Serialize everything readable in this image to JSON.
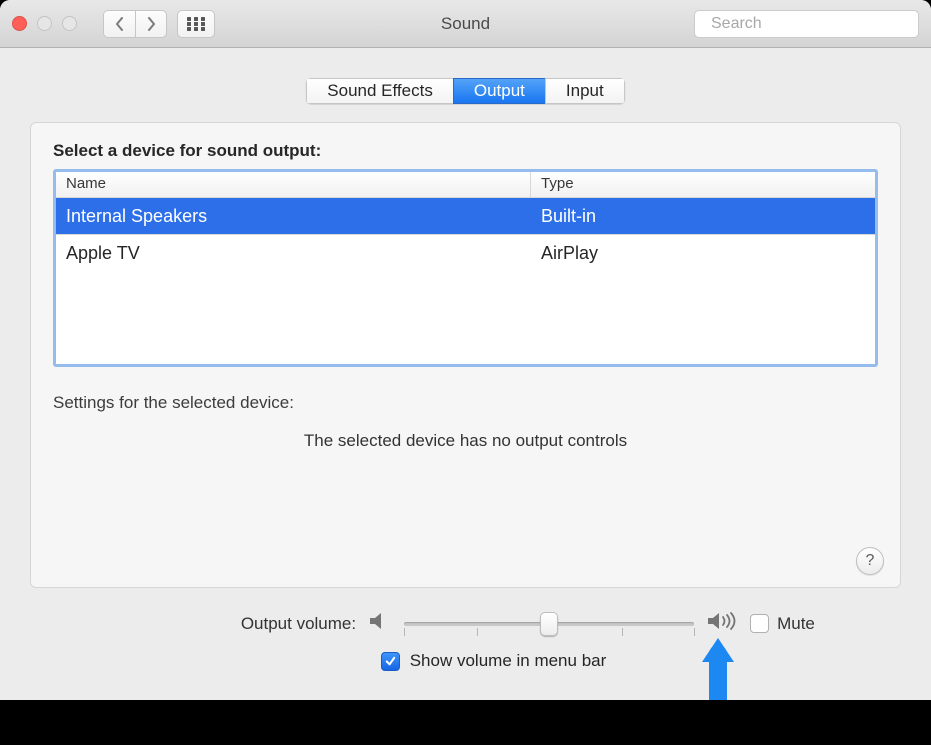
{
  "window": {
    "title": "Sound"
  },
  "search": {
    "placeholder": "Search"
  },
  "tabs": [
    {
      "label": "Sound Effects",
      "active": false
    },
    {
      "label": "Output",
      "active": true
    },
    {
      "label": "Input",
      "active": false
    }
  ],
  "section_title": "Select a device for sound output:",
  "columns": {
    "name": "Name",
    "type": "Type"
  },
  "devices": [
    {
      "name": "Internal Speakers",
      "type": "Built-in",
      "selected": true
    },
    {
      "name": "Apple TV",
      "type": "AirPlay",
      "selected": false
    }
  ],
  "settings_label": "Settings for the selected device:",
  "no_controls_message": "The selected device has no output controls",
  "volume": {
    "label": "Output volume:",
    "value": 0.5,
    "mute_label": "Mute",
    "mute_checked": false
  },
  "show_in_menubar": {
    "label": "Show volume in menu bar",
    "checked": true
  },
  "help_label": "?"
}
